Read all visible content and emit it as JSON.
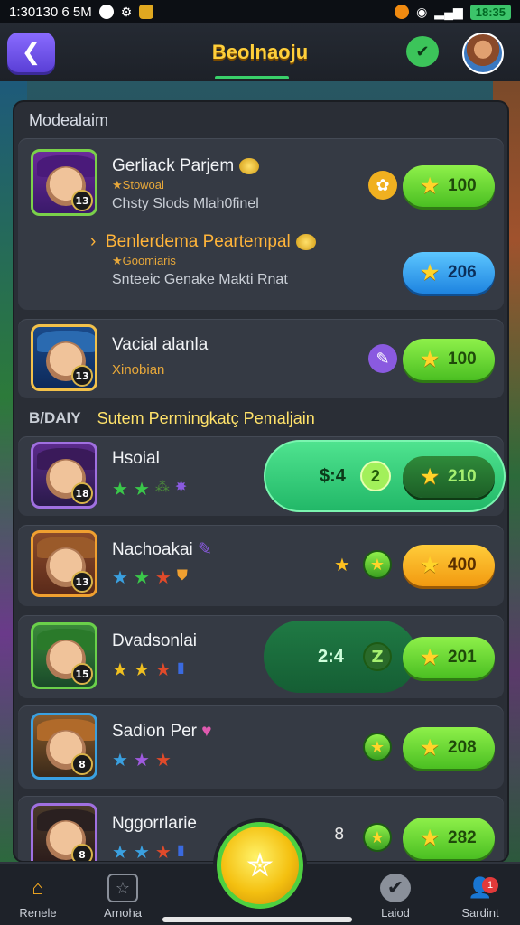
{
  "status_bar": {
    "left_text": "1:30130 6 5M",
    "time": "18:35"
  },
  "header": {
    "title": "Beolnaoju",
    "back_icon": "back-arrow-icon",
    "chat_icon": "chat-check-icon"
  },
  "section_title": "Modealaim",
  "featured": [
    {
      "name": "Gerliack Parjem",
      "sub": "Stowoal",
      "desc": "Chsty Slods Mlah0finel",
      "price": "100",
      "price_color": "green"
    },
    {
      "name": "Benlerdema Peartempal",
      "sub": "Goomiaris",
      "desc": "Snteeic Genake Makti Rnat",
      "price": "206",
      "price_color": "blue"
    },
    {
      "name": "Vacial alanla",
      "sub": "Xinobian",
      "desc": "",
      "price": "100",
      "price_color": "green"
    }
  ],
  "ranking": {
    "tag": "B/DAIY",
    "title": "Sutem Permingkatç Pemaljain"
  },
  "players": [
    {
      "name": "Hsoial",
      "level": "18",
      "banner_value": "$:4",
      "banner_badge": "2",
      "price": "210",
      "style": "bright-banner"
    },
    {
      "name": "Nachoakai",
      "level": "13",
      "price": "400",
      "style": "orange"
    },
    {
      "name": "Dvadsonlai",
      "level": "15",
      "banner_value": "2:4",
      "banner_badge": "Z",
      "price": "201",
      "style": "dark-banner"
    },
    {
      "name": "Sadion Per",
      "level": "8",
      "price": "208",
      "style": "green"
    },
    {
      "name": "Nggorrlarie",
      "level": "8",
      "extra": "8",
      "price": "282",
      "style": "green"
    }
  ],
  "bottom_nav": [
    {
      "label": "Renele",
      "icon": "home-icon"
    },
    {
      "label": "Arnoha",
      "icon": "board-icon"
    },
    {
      "label": "Laiod",
      "icon": "badge-check-icon"
    },
    {
      "label": "Sardint",
      "icon": "profile-icon",
      "badge": "1"
    }
  ],
  "colors": {
    "accent_green": "#4bbf22",
    "accent_yellow": "#ffcf3a",
    "panel": "#2a2e36",
    "card": "#353a44"
  }
}
